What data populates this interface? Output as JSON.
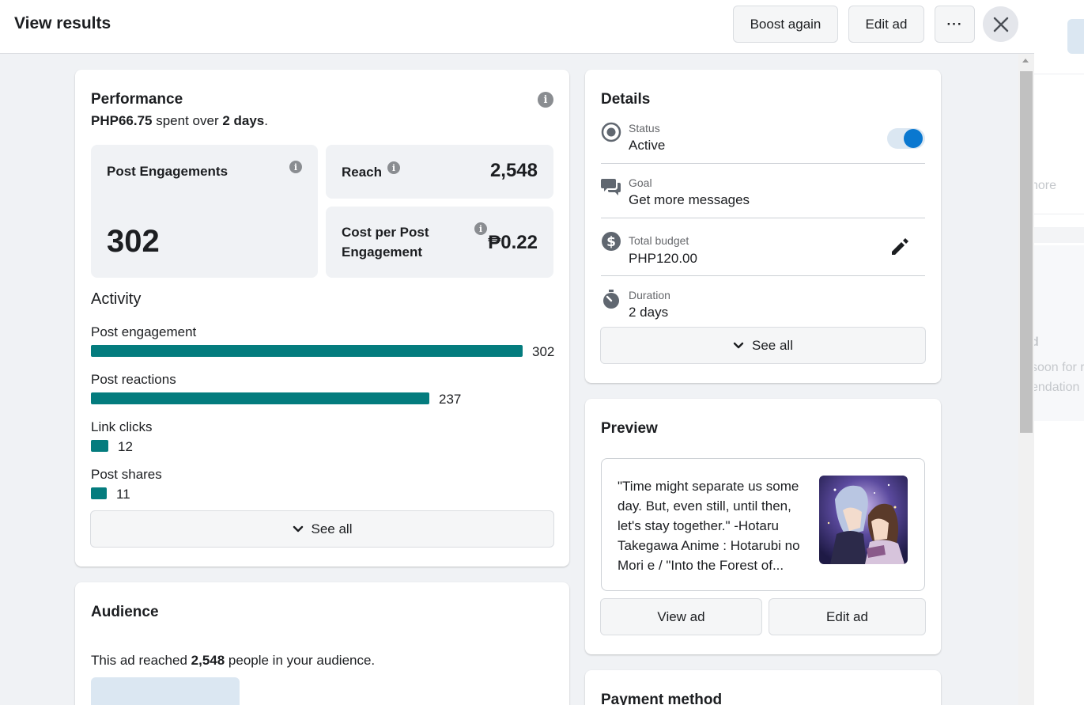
{
  "header": {
    "title": "View results",
    "boost_again": "Boost again",
    "edit_ad": "Edit ad",
    "more": "···"
  },
  "performance": {
    "title": "Performance",
    "spent_amount": "PHP66.75",
    "spent_mid": " spent over ",
    "spent_days": "2 days",
    "spent_end": ".",
    "metrics": {
      "engagements_label": "Post Engagements",
      "engagements_value": "302",
      "reach_label": "Reach",
      "reach_value": "2,548",
      "cost_label": "Cost per Post Engagement",
      "cost_value": "₱0.22"
    },
    "activity_title": "Activity",
    "activity": [
      {
        "label": "Post engagement",
        "value": "302",
        "amount": 302
      },
      {
        "label": "Post reactions",
        "value": "237",
        "amount": 237
      },
      {
        "label": "Link clicks",
        "value": "12",
        "amount": 12
      },
      {
        "label": "Post shares",
        "value": "11",
        "amount": 11
      }
    ],
    "see_all": "See all"
  },
  "audience": {
    "title": "Audience",
    "text_pre": "This ad reached ",
    "text_num": "2,548",
    "text_post": " people in your audience."
  },
  "details": {
    "title": "Details",
    "status_label": "Status",
    "status_value": "Active",
    "status_on": true,
    "goal_label": "Goal",
    "goal_value": "Get more messages",
    "budget_label": "Total budget",
    "budget_value": "PHP120.00",
    "duration_label": "Duration",
    "duration_value": "2 days",
    "see_all": "See all"
  },
  "preview": {
    "title": "Preview",
    "text": "\"Time might separate us some day. But, even still, until then, let's stay together.\" -Hotaru Takegawa Anime : Hotarubi no Mori e / \"Into the Forest of...",
    "view_ad": "View ad",
    "edit_ad": "Edit ad"
  },
  "payment": {
    "title": "Payment method"
  },
  "background": {
    "text1": "nore",
    "text2": "d",
    "text3": "soon for r",
    "text4": "endation"
  },
  "colors": {
    "bar": "#047c7e",
    "toggle": "#0a78d0",
    "surface": "#f0f2f5"
  }
}
